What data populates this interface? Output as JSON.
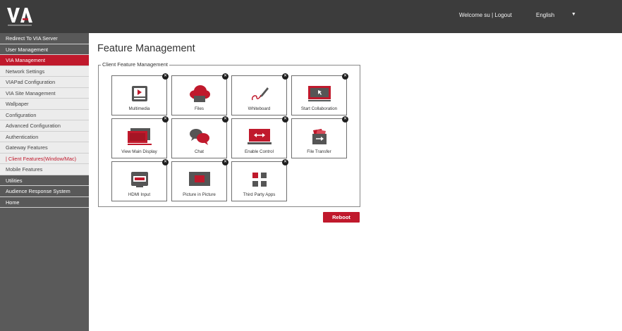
{
  "header": {
    "welcome_text": "Welcome su",
    "separator": "|",
    "logout_label": "Logout",
    "language": "English",
    "language_caret": "▼"
  },
  "sidebar": {
    "items": [
      {
        "label": "Redirect To VIA Server",
        "style": "dark"
      },
      {
        "label": "User Management",
        "style": "dark"
      },
      {
        "label": "VIA Management",
        "style": "red"
      },
      {
        "label": "Network Settings",
        "style": "light"
      },
      {
        "label": "VIAPad Configuration",
        "style": "light"
      },
      {
        "label": "VIA Site Management",
        "style": "light"
      },
      {
        "label": "Wallpaper",
        "style": "light"
      },
      {
        "label": "Configuration",
        "style": "light"
      },
      {
        "label": "Advanced Configuration",
        "style": "light"
      },
      {
        "label": "Authentication",
        "style": "light"
      },
      {
        "label": "Gateway Features",
        "style": "light"
      },
      {
        "label": "| Client Features(Window/Mac)",
        "style": "sub"
      },
      {
        "label": "Mobile Features",
        "style": "light"
      },
      {
        "label": "Utilities",
        "style": "dark"
      },
      {
        "label": "Audience Response System",
        "style": "dark"
      },
      {
        "label": "Home",
        "style": "dark"
      }
    ]
  },
  "main": {
    "title": "Feature Management",
    "legend": "Client Feature Management",
    "close_glyph": "✕",
    "features": [
      {
        "label": "Multimedia",
        "icon": "multimedia-icon"
      },
      {
        "label": "Files",
        "icon": "cloud-files-icon"
      },
      {
        "label": "Whiteboard",
        "icon": "whiteboard-pen-icon"
      },
      {
        "label": "Start Collaboration",
        "icon": "collaboration-screen-icon"
      },
      {
        "label": "View Main Display",
        "icon": "main-display-icon"
      },
      {
        "label": "Chat",
        "icon": "chat-bubbles-icon"
      },
      {
        "label": "Enable Control",
        "icon": "enable-control-icon"
      },
      {
        "label": "File Transfer",
        "icon": "file-transfer-icon"
      },
      {
        "label": "HDMI Input",
        "icon": "hdmi-input-icon"
      },
      {
        "label": "Picture in Picture",
        "icon": "picture-in-picture-icon"
      },
      {
        "label": "Third Party Apps",
        "icon": "third-party-apps-icon"
      }
    ],
    "reboot_label": "Reboot"
  },
  "colors": {
    "accent": "#c0192c",
    "topbar": "#3c3c3c",
    "sidebar": "#5a5a5a"
  }
}
